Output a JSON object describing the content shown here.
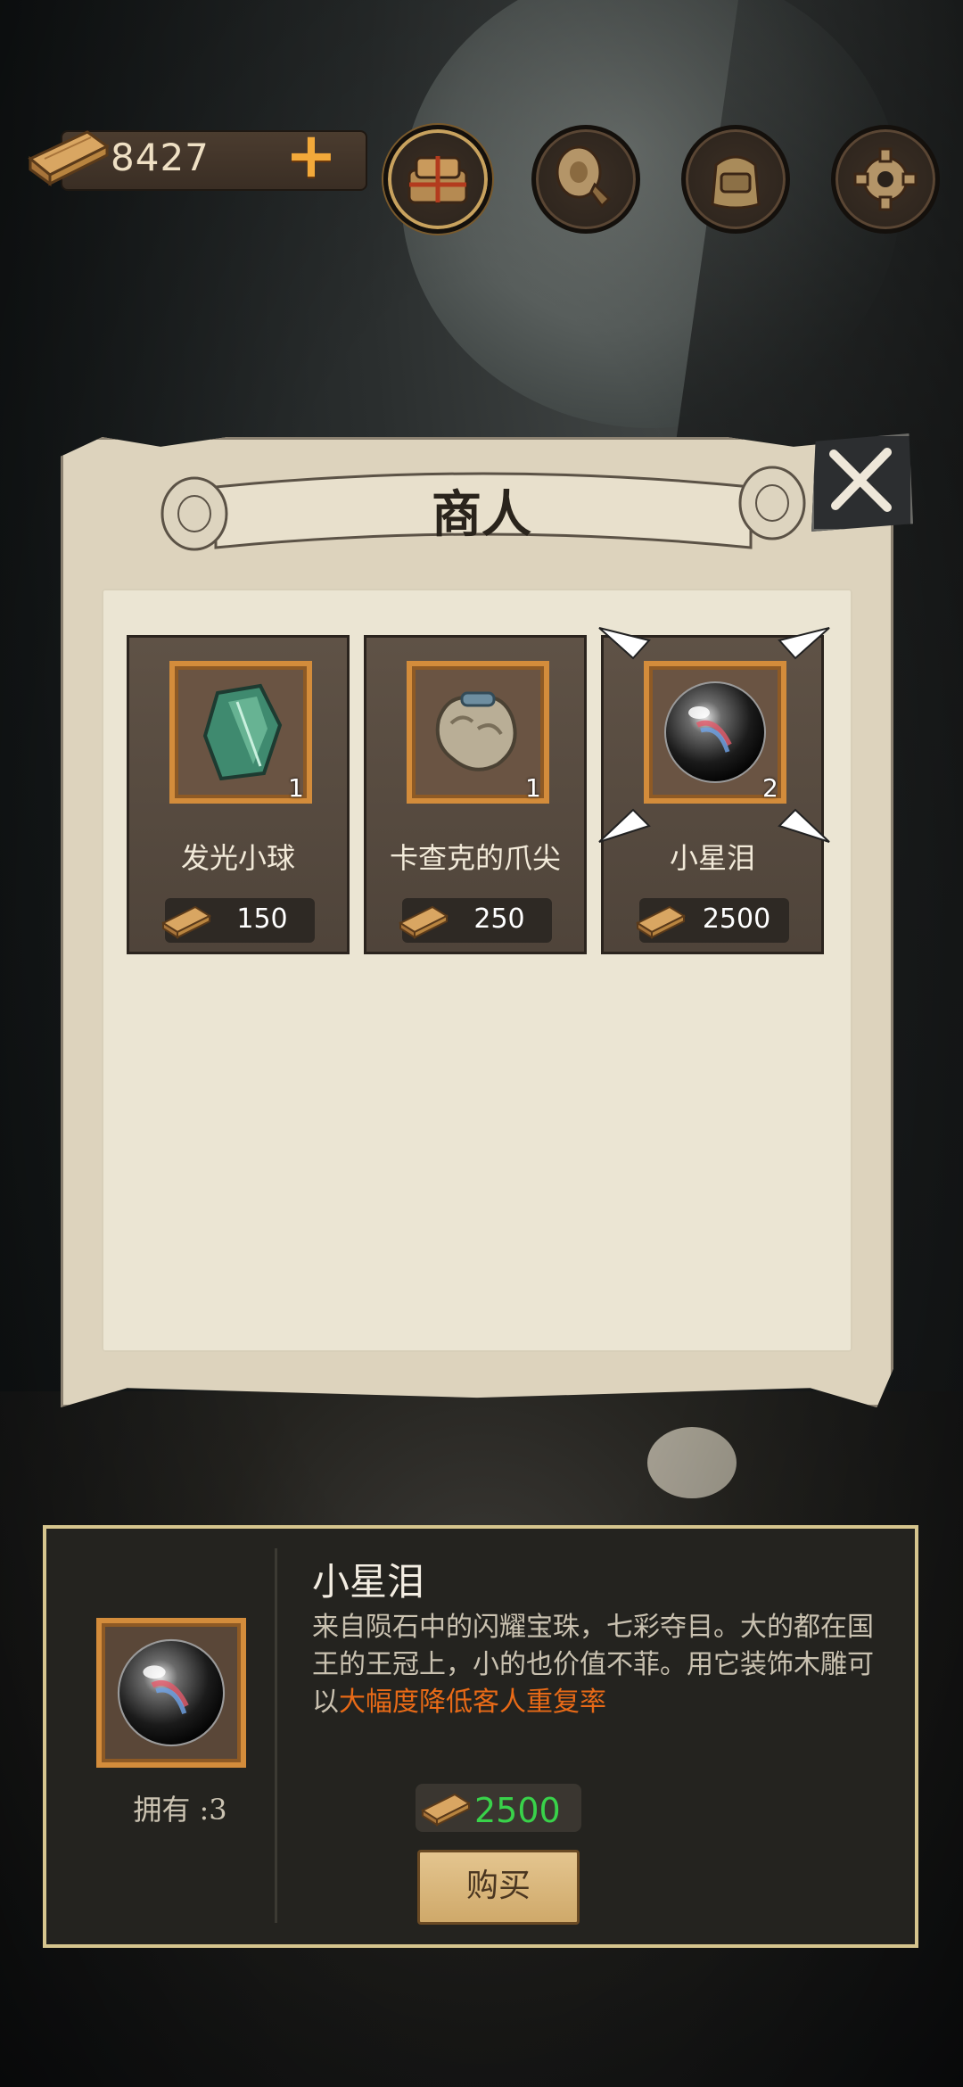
{
  "topbar": {
    "wood_count": "8427",
    "buttons": [
      {
        "name": "supplies-bundle-icon",
        "active": true
      },
      {
        "name": "gramophone-icon",
        "active": false
      },
      {
        "name": "backpack-icon",
        "active": false
      },
      {
        "name": "gear-icon",
        "active": false
      }
    ]
  },
  "merchant": {
    "title": "商人",
    "items": [
      {
        "name": "发光小球",
        "qty": "1",
        "price": "150",
        "icon": "green-crystal-icon",
        "selected": false
      },
      {
        "name": "卡查克的爪尖",
        "qty": "1",
        "price": "250",
        "icon": "claw-icon",
        "selected": false
      },
      {
        "name": "小星泪",
        "qty": "2",
        "price": "2500",
        "icon": "star-tear-orb-icon",
        "selected": true
      }
    ]
  },
  "detail": {
    "name": "小星泪",
    "description_part1": "来自陨石中的闪耀宝珠，七彩夺目。大的都在国王的王冠上，小的也价值不菲。用它装饰木雕可以",
    "description_highlight": "大幅度降低客人重复率",
    "owned": "拥有 :3",
    "price": "2500",
    "buy_label": "购买"
  },
  "colors": {
    "price_green": "#39d24a",
    "highlight_orange": "#e86a17",
    "frame_orange": "#d38c3b"
  }
}
